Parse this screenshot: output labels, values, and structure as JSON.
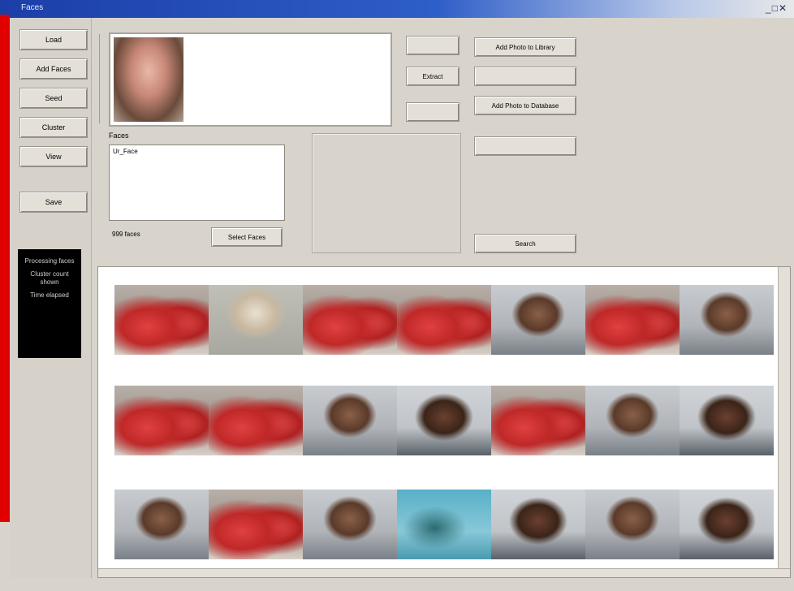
{
  "window": {
    "title": "Faces",
    "controls": "_□✕"
  },
  "nav": {
    "buttons": [
      "Load",
      "Add Faces",
      "Seed",
      "Cluster",
      "View",
      "Save"
    ],
    "status_lines": [
      "Processing faces",
      "Cluster count shown",
      "Time elapsed"
    ]
  },
  "top": {
    "btn_a": "",
    "btn_b": "Extract",
    "btn_c": "",
    "btn_add_photo": "Add Photo to Library",
    "btn_blank": "",
    "btn_add_photo2": "Add Photo to Database",
    "btn_disabled": "",
    "btn_search": "Search"
  },
  "list": {
    "label": "Faces",
    "items": [
      "Ur_Face"
    ],
    "count": "999 faces",
    "select_button": "Select Faces"
  },
  "icons": {
    "photo": "face-photo-icon",
    "thumbs": "photo-thumbnail"
  },
  "thumbnails": [
    [
      "raft",
      "elder",
      "raft",
      "raft",
      "person",
      "raft",
      "person"
    ],
    [
      "raft",
      "raft",
      "person",
      "person-dark",
      "raft",
      "person",
      "person-dark"
    ],
    [
      "person",
      "raft",
      "person",
      "teal",
      "person-dark",
      "person",
      "person-dark"
    ]
  ]
}
